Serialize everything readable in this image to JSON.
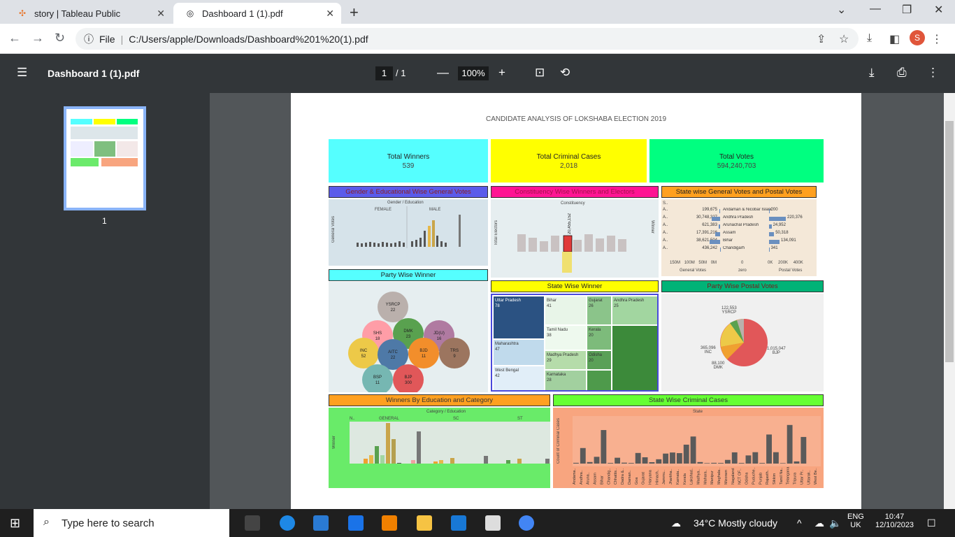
{
  "tabs": [
    {
      "label": "story | Tableau Public",
      "icon": "tableau-icon"
    },
    {
      "label": "Dashboard 1 (1).pdf",
      "icon": "globe-icon"
    }
  ],
  "address": {
    "scheme": "File",
    "url": "C:/Users/apple/Downloads/Dashboard%201%20(1).pdf"
  },
  "profile": "S",
  "pdf": {
    "title": "Dashboard 1 (1).pdf",
    "page": "1",
    "of": "/ 1",
    "zoom": "100%",
    "thumb_num": "1"
  },
  "dashboard": {
    "title": "CANDIDATE ANALYSIS OF LOKSHABA ELECTION 2019",
    "kpis": [
      {
        "label": "Total Winners",
        "value": "539",
        "color": "#55ffff"
      },
      {
        "label": "Total Criminal Cases",
        "value": "2,018",
        "color": "#ffff00"
      },
      {
        "label": "Total Votes",
        "value": "594,240,703",
        "color": "#00ff80"
      }
    ],
    "headers": {
      "gender": "Gender & Educational Wise General Votes",
      "constituency": "Constituency Wise Winners and Electors",
      "statevotes": "State wise General Votes and Postal Votes",
      "party": "Party Wise Winner",
      "statewinner": "State Wise Winner",
      "postal": "Party Wise Postal Votes",
      "education": "Winners By Education and Category",
      "criminal": "State Wise Criminal Cases"
    },
    "gender_sub": "Gender / Education",
    "female": "FEMALE",
    "male": "MALE",
    "gv": "General Votes",
    "const_sub": "Constituency",
    "electors": "Total Electors",
    "winner": "Winner",
    "const_val": "20,455,152",
    "sv_cols": [
      "General Votes",
      "zero",
      "Postal Votes"
    ],
    "sv_rows": [
      [
        "199,675",
        "Andaman & Nicobar Islands",
        "200"
      ],
      [
        "30,748,327",
        "Andhra Pradesh",
        "220,376"
      ],
      [
        "621,383",
        "Arunachal Pradesh",
        "24,952"
      ],
      [
        "17,391,216",
        "Assam",
        "50,318"
      ],
      [
        "38,621,504",
        "Bihar",
        "134,091"
      ],
      [
        "436,242",
        "Chandigarh",
        "341"
      ]
    ],
    "sv_s": "S..",
    "sv_axis": [
      "150M",
      "100M",
      "50M",
      "0M",
      "0",
      "0K",
      "200K",
      "400K"
    ],
    "party_bubbles": [
      {
        "n": "YSRCP",
        "v": "22",
        "c": "#bab0ac"
      },
      {
        "n": "SHS",
        "v": "18",
        "c": "#ff9da7"
      },
      {
        "n": "DMK",
        "v": "23",
        "c": "#59a14f"
      },
      {
        "n": "JD(U)",
        "v": "16",
        "c": "#b07aa1"
      },
      {
        "n": "INC",
        "v": "52",
        "c": "#edc948"
      },
      {
        "n": "AITC",
        "v": "22",
        "c": "#4e79a7"
      },
      {
        "n": "BJD",
        "v": "11",
        "c": "#f28e2b"
      },
      {
        "n": "TRS",
        "v": "9",
        "c": "#9c755f"
      },
      {
        "n": "BSP",
        "v": "11",
        "c": "#76b7b2"
      },
      {
        "n": "BJP",
        "v": "300",
        "c": "#e15759"
      }
    ],
    "tree": [
      {
        "n": "Uttar Pradesh",
        "v": "78"
      },
      {
        "n": "Bihar",
        "v": "41"
      },
      {
        "n": "Gujarat",
        "v": "26"
      },
      {
        "n": "Andhra Pradesh",
        "v": "25"
      },
      {
        "n": "Tamil Nadu",
        "v": "38"
      },
      {
        "n": "Kerala",
        "v": "20"
      },
      {
        "n": "Maharashtra",
        "v": "47"
      },
      {
        "n": "Madhya Pradesh",
        "v": "29"
      },
      {
        "n": "Odisha",
        "v": "20"
      },
      {
        "n": "West Bengal",
        "v": "42"
      },
      {
        "n": "Karnataka",
        "v": "28"
      }
    ],
    "pie": [
      {
        "l": "122,553",
        "n": "YSRCP"
      },
      {
        "l": "1,015,047",
        "n": "BJP"
      },
      {
        "l": "365,096",
        "n": "INC"
      },
      {
        "l": "88,100",
        "n": "DMK"
      }
    ],
    "edu_sub": "Category / Education",
    "edu_cats": [
      "N..",
      "GENERAL",
      "SC",
      "ST"
    ],
    "edu_y": "Winner",
    "edu_vals": [
      "0",
      "49",
      "303",
      "73",
      "1",
      "96",
      "10",
      "18",
      "0",
      "25",
      "10",
      "14",
      "14"
    ],
    "crim_sub": "State",
    "crim_y": "Count of Criminal Cases",
    "crim_vals": [
      "5",
      "101",
      "10",
      "44",
      "218",
      "4",
      "38",
      "6",
      "4",
      "69",
      "41",
      "9",
      "28",
      "65",
      "72",
      "68",
      "123",
      "176",
      "10",
      "3",
      "5",
      "4",
      "24",
      "73",
      "4",
      "53",
      "74",
      "4",
      "189",
      "74",
      "3",
      "251",
      "14",
      "173"
    ],
    "crim_states": [
      "Andama..",
      "Andhra..",
      "Aruna..",
      "Assam",
      "Bihar",
      "Chandig..",
      "Chhattis..",
      "Dadra &..",
      "Daman..",
      "Goa",
      "Gujarat",
      "Haryana",
      "Himach..",
      "Jammu..",
      "Jharkha..",
      "Karnata..",
      "Kerala",
      "Lakshad..",
      "Madhya..",
      "Mahara..",
      "Manipur",
      "Meghala..",
      "Mizoram",
      "Nagaland",
      "NCT OF..",
      "Odisha",
      "Puduche..",
      "Punjab",
      "Rajasth..",
      "Sikkim",
      "Tamil Na..",
      "Telangana",
      "Tripura",
      "Uttar Pr..",
      "Uttarak..",
      "West Be.."
    ]
  },
  "taskbar": {
    "search": "Type here to search",
    "weather": "34°C  Mostly cloudy",
    "lang1": "ENG",
    "lang2": "UK",
    "time": "10:47",
    "date": "12/10/2023"
  }
}
